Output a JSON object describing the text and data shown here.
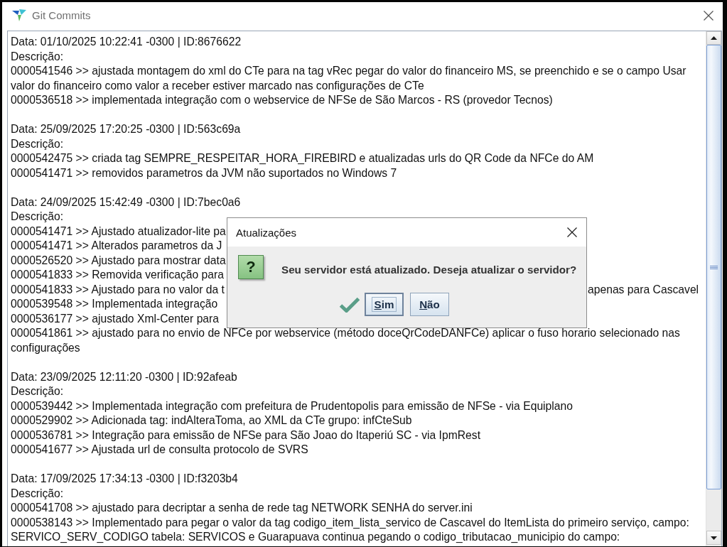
{
  "window": {
    "title": "Git Commits"
  },
  "commits": [
    {
      "header": "Data: 01/10/2025 10:22:41 -0300 | ID:8676622",
      "label": "Descrição:",
      "entries": [
        {
          "text": "0000541546 >> ajustada montagem do xml do CTe para na tag vRec pegar do valor do financeiro MS, se preenchido e se o campo Usar valor do financeiro como valor a receber estiver marcado nas configurações de CTe"
        },
        {
          "text": "0000536518 >> implementada integração com o webservice de NFSe de São Marcos - RS (provedor Tecnos)"
        }
      ]
    },
    {
      "header": "Data: 25/09/2025 17:20:25 -0300 | ID:563c69a",
      "label": "Descrição:",
      "entries": [
        {
          "text": "0000542475 >> criada tag SEMPRE_RESPEITAR_HORA_FIREBIRD e atualizadas urls do QR Code da NFCe do AM"
        },
        {
          "text": "0000541471 >> removidos parametros da JVM não suportados no Windows 7"
        }
      ]
    },
    {
      "header": "Data: 24/09/2025 15:42:49 -0300 | ID:7bec0a6",
      "label": "Descrição:",
      "entries": [
        {
          "text": "0000541471 >> Ajustado atualizador-lite pa"
        },
        {
          "text": "0000541471 >> Alterados parametros da J"
        },
        {
          "text": "0000526520 >> Ajustado para mostrar data"
        },
        {
          "text": "0000541833 >> Removida verificação para"
        },
        {
          "text": "0000541833 >> Ajustado para no valor da t",
          "text_after_dialog": "apenas para Cascavel"
        },
        {
          "text": "0000539548 >> Implementada integração"
        },
        {
          "text": "0000536177 >> ajustado Xml-Center para"
        },
        {
          "text": "0000541861 >> ajustado para no envio de NFCe por webservice (método doceQrCodeDANFCe) aplicar o fuso horario selecionado nas configurações"
        }
      ]
    },
    {
      "header": "Data: 23/09/2025 12:11:20 -0300 | ID:92afeab",
      "label": "Descrição:",
      "entries": [
        {
          "text": "0000539442 >> Implementada integração com prefeitura de Prudentopolis para emissão de NFSe - via Equiplano"
        },
        {
          "text": "0000529902 >> Adicionada tag: indAlteraToma, ao XML da CTe grupo: infCteSub"
        },
        {
          "text": "0000536781 >> Integração para emissão de NFSe para São Joao do Itaperiú SC - via IpmRest"
        },
        {
          "text": "0000541677 >> Ajustada url de consulta protocolo de SVRS"
        }
      ]
    },
    {
      "header": "Data: 17/09/2025 17:34:13 -0300 | ID:f3203b4",
      "label": "Descrição:",
      "entries": [
        {
          "text": "0000541708 >> ajustado para decriptar a senha de rede tag NETWORK SENHA do server.ini"
        },
        {
          "text": "0000538143 >> Implementado para pegar o valor da tag codigo_item_lista_servico de Cascavel do ItemLista do primeiro serviço, campo: SERVICO_SERV_CODIGO tabela: SERVICOS e Guarapuava continua pegando o codigo_tributacao_municipio do campo:"
        }
      ]
    }
  ],
  "dialog": {
    "title": "Atualizações",
    "icon_glyph": "?",
    "message": "Seu servidor está atualizado. Deseja atualizar o servidor?",
    "buttons": [
      {
        "label": "Sim",
        "focused": true
      },
      {
        "label": "Não",
        "focused": false
      }
    ]
  }
}
